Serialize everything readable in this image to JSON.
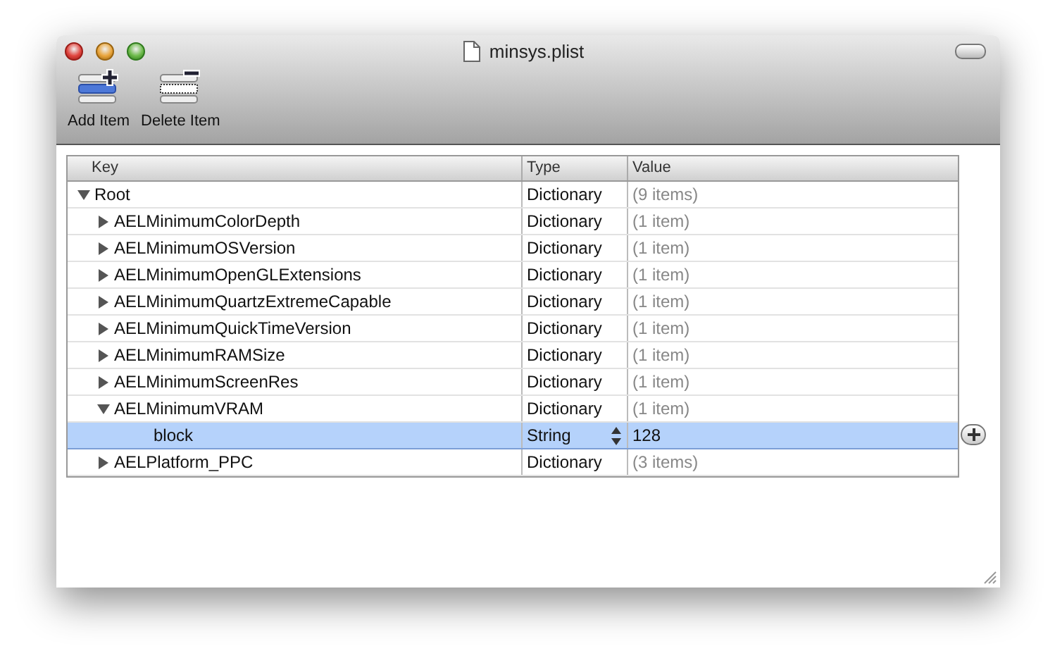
{
  "window": {
    "title": "minsys.plist"
  },
  "toolbar": [
    {
      "kind": "add",
      "label": "Add Item"
    },
    {
      "kind": "delete",
      "label": "Delete Item"
    }
  ],
  "table": {
    "columns": [
      "Key",
      "Type",
      "Value"
    ],
    "rows": [
      {
        "key": "Root",
        "type": "Dictionary",
        "value": "(9 items)",
        "expanded": true,
        "selected": false,
        "children": [
          {
            "key": "AELMinimumColorDepth",
            "type": "Dictionary",
            "value": "(1 item)",
            "expanded": false,
            "selected": false
          },
          {
            "key": "AELMinimumOSVersion",
            "type": "Dictionary",
            "value": "(1 item)",
            "expanded": false,
            "selected": false
          },
          {
            "key": "AELMinimumOpenGLExtensions",
            "type": "Dictionary",
            "value": "(1 item)",
            "expanded": false,
            "selected": false
          },
          {
            "key": "AELMinimumQuartzExtremeCapable",
            "type": "Dictionary",
            "value": "(1 item)",
            "expanded": false,
            "selected": false
          },
          {
            "key": "AELMinimumQuickTimeVersion",
            "type": "Dictionary",
            "value": "(1 item)",
            "expanded": false,
            "selected": false
          },
          {
            "key": "AELMinimumRAMSize",
            "type": "Dictionary",
            "value": "(1 item)",
            "expanded": false,
            "selected": false
          },
          {
            "key": "AELMinimumScreenRes",
            "type": "Dictionary",
            "value": "(1 item)",
            "expanded": false,
            "selected": false
          },
          {
            "key": "AELMinimumVRAM",
            "type": "Dictionary",
            "value": "(1 item)",
            "expanded": true,
            "selected": false,
            "children": [
              {
                "key": "block",
                "type": "String",
                "value": "128",
                "selected": true
              }
            ]
          },
          {
            "key": "AELPlatform_PPC",
            "type": "Dictionary",
            "value": "(3 items)",
            "expanded": false,
            "selected": false
          }
        ]
      }
    ]
  }
}
